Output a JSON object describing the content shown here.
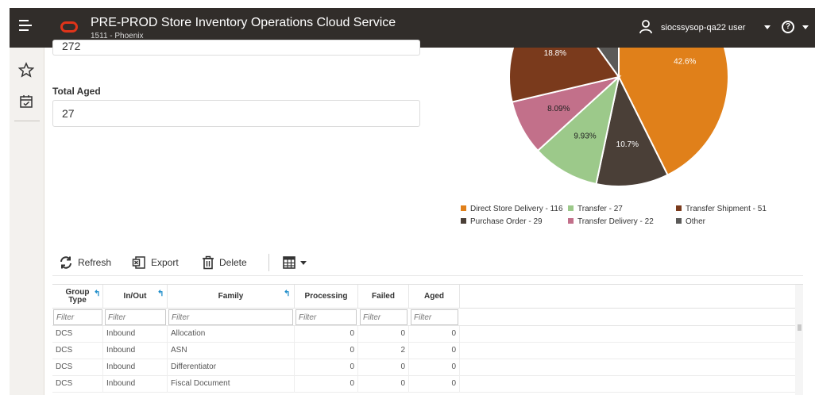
{
  "header": {
    "title": "PRE-PROD Store Inventory Operations Cloud Service",
    "store": "1511 - Phoenix",
    "user": "siocssysop-qa22 user",
    "help_glyph": "?"
  },
  "fields": {
    "top_value": "272",
    "total_aged_label": "Total Aged",
    "total_aged_value": "27"
  },
  "chart_data": {
    "type": "pie",
    "slices": [
      {
        "name": "Direct Store Delivery",
        "value": 116,
        "label": "42.6%",
        "color": "#e0801a"
      },
      {
        "name": "Purchase Order",
        "value": 29,
        "label": "10.7%",
        "color": "#4a3f37"
      },
      {
        "name": "Transfer",
        "value": 27,
        "label": "9.93%",
        "color": "#9cc98a"
      },
      {
        "name": "Transfer Delivery",
        "value": 22,
        "label": "8.09%",
        "color": "#c2708a"
      },
      {
        "name": "Transfer Shipment",
        "value": 51,
        "label": "18.8%",
        "color": "#7a3a1c"
      },
      {
        "name": "Other",
        "value": 27,
        "label": "",
        "color": "#5b5a58"
      }
    ],
    "legend": [
      "Direct Store Delivery - 116",
      "Transfer - 27",
      "Transfer Shipment - 51",
      "Purchase Order - 29",
      "Transfer Delivery - 22",
      "Other"
    ]
  },
  "toolbar": {
    "refresh": "Refresh",
    "export": "Export",
    "delete": "Delete"
  },
  "table": {
    "columns": [
      "Group Type",
      "In/Out",
      "Family",
      "Processing",
      "Failed",
      "Aged"
    ],
    "filter_placeholder": "Filter",
    "rows": [
      [
        "DCS",
        "Inbound",
        "Allocation",
        "0",
        "0",
        "0"
      ],
      [
        "DCS",
        "Inbound",
        "ASN",
        "0",
        "2",
        "0"
      ],
      [
        "DCS",
        "Inbound",
        "Differentiator",
        "0",
        "0",
        "0"
      ],
      [
        "DCS",
        "Inbound",
        "Fiscal Document",
        "0",
        "0",
        "0"
      ]
    ]
  },
  "colors": {
    "topbar": "#312d2a",
    "logo": "#e0341a",
    "sort_accent": "#1a8bc9"
  }
}
